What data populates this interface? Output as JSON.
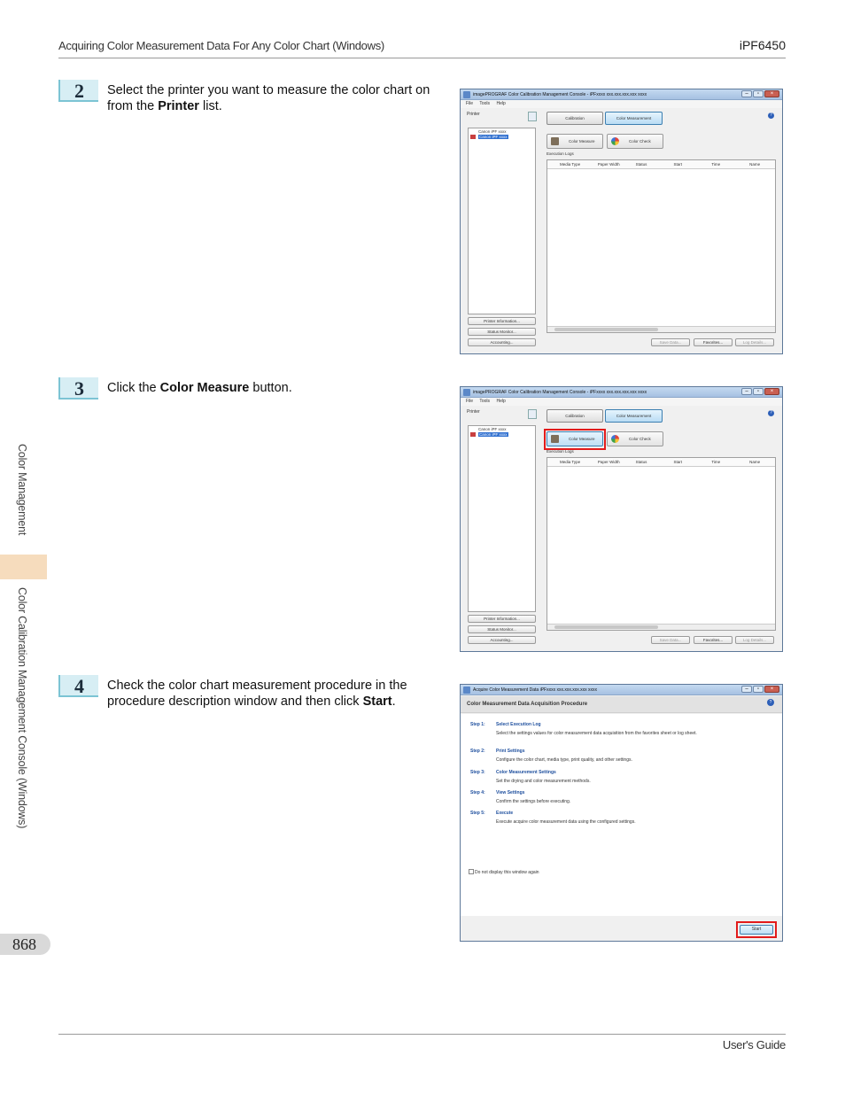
{
  "header": {
    "title": "Acquiring Color Measurement Data For Any Color Chart (Windows)",
    "model": "iPF6450"
  },
  "footer": {
    "guide": "User's Guide",
    "page": "868"
  },
  "side_tabs": {
    "section": "Color Management",
    "chapter": "Color Calibration Management Console (Windows)"
  },
  "steps": [
    {
      "number": "2",
      "text_before": "Select the printer you want to measure the color chart on from the ",
      "bold": "Printer",
      "text_after": " list."
    },
    {
      "number": "3",
      "text_before": "Click the ",
      "bold": "Color Measure",
      "text_after": " button."
    },
    {
      "number": "4",
      "text_before": "Check the color chart measurement procedure in the procedure description window and then click ",
      "bold": "Start",
      "text_after": "."
    }
  ],
  "console": {
    "title": "imagePROGRAF Color Calibration Management Console - iPFxxxx xxx.xxx.xxx.xxx xxxx",
    "menu": [
      "File",
      "Tools",
      "Help"
    ],
    "printer_label": "Printer",
    "printers": [
      "Canon iPF xxxx",
      "Canon iPF xxxx"
    ],
    "left_buttons": [
      "Printer Information...",
      "Status Monitor...",
      "Accounting..."
    ],
    "tabs": [
      "Calibration",
      "Color Measurement"
    ],
    "actions": [
      "Color Measure",
      "Color Check"
    ],
    "exec_label": "Execution Logs",
    "columns": [
      "Media Type",
      "Paper Width",
      "Status",
      "Start",
      "Time",
      "Name"
    ],
    "bottom_buttons": [
      "Save Data...",
      "Favorites...",
      "Log Details..."
    ],
    "help": "?"
  },
  "procedure": {
    "title": "Acquire Color Measurement Data  iPFxxxx xxx.xxx.xxx.xxx xxxx",
    "heading": "Color Measurement Data Acquisition Procedure",
    "steps": [
      {
        "num": "Step 1:",
        "title": "Select Execution Log",
        "desc": "Select the settings values for color measurement data acquisition from the favorites sheet or log sheet."
      },
      {
        "num": "Step 2:",
        "title": "Print Settings",
        "desc": "Configure the color chart, media type, print quality, and other settings."
      },
      {
        "num": "Step 3:",
        "title": "Color Measurement Settings",
        "desc": "Set the drying and color measurement methods."
      },
      {
        "num": "Step 4:",
        "title": "View Settings",
        "desc": "Confirm the settings before executing."
      },
      {
        "num": "Step 5:",
        "title": "Execute",
        "desc": "Execute acquire color measurement data using the configured settings."
      }
    ],
    "checkbox": "Do not display this window again",
    "start": "Start"
  },
  "colors": {
    "highlight": "#e21b1b",
    "step_badge": "#d7eef4",
    "side_tab": "#f6dcbd",
    "link_blue": "#1e4f9e"
  }
}
